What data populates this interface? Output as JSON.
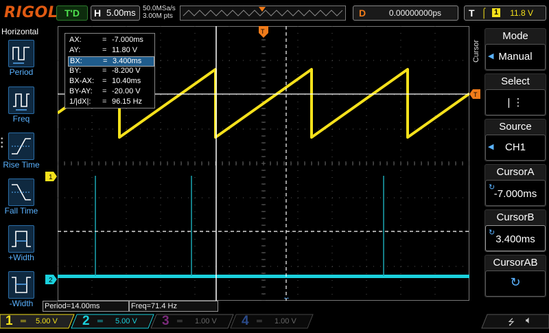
{
  "topbar": {
    "brand": "RIGOL",
    "run_status": "T'D",
    "horizontal": {
      "key": "H",
      "value": "5.00ms"
    },
    "sample_rate": "50.0MSa/s",
    "memory_depth": "3.00M pts",
    "delay": {
      "key": "D",
      "value": "0.00000000ps"
    },
    "trigger": {
      "key": "T",
      "source": "1",
      "level": "11.8 V"
    }
  },
  "left_menu": {
    "title": "Horizontal",
    "items": [
      {
        "label": "Period",
        "icon": "period-icon"
      },
      {
        "label": "Freq",
        "icon": "freq-icon"
      },
      {
        "label": "Rise Time",
        "icon": "rise-time-icon"
      },
      {
        "label": "Fall Time",
        "icon": "fall-time-icon"
      },
      {
        "label": "+Width",
        "icon": "positive-width-icon"
      },
      {
        "label": "-Width",
        "icon": "negative-width-icon"
      }
    ]
  },
  "cursor_readout": [
    {
      "k": "AX:",
      "e": "=",
      "v": "-7.000ms"
    },
    {
      "k": "AY:",
      "e": "=",
      "v": "11.80 V"
    },
    {
      "k": "BX:",
      "e": "=",
      "v": "3.400ms"
    },
    {
      "k": "BY:",
      "e": "=",
      "v": "-8.200 V"
    },
    {
      "k": "BX-AX:",
      "e": "=",
      "v": "10.40ms"
    },
    {
      "k": "BY-AY:",
      "e": "=",
      "v": "-20.00 V"
    },
    {
      "k": "1/|dX|:",
      "e": "=",
      "v": "96.15 Hz"
    }
  ],
  "markers": {
    "ch1": "1",
    "ch2": "2",
    "trigger_marker": "T"
  },
  "right_menu": {
    "vertical_title": "Cursor",
    "items": [
      {
        "title": "Mode",
        "value": "Manual"
      },
      {
        "title": "Select",
        "value": "| ⋮"
      },
      {
        "title": "Source",
        "value": "CH1"
      },
      {
        "title": "CursorA",
        "value": "-7.000ms"
      },
      {
        "title": "CursorB",
        "value": "3.400ms"
      },
      {
        "title": "CursorAB",
        "value": ""
      }
    ]
  },
  "measurements": {
    "period": "Period=14.00ms",
    "freq": "Freq=71.4 Hz"
  },
  "channels": [
    {
      "num": "1",
      "scale": "5.00 V",
      "color": "#f5e11b",
      "active": true
    },
    {
      "num": "2",
      "scale": "5.00 V",
      "color": "#1ad1dd",
      "active": true
    },
    {
      "num": "3",
      "scale": "1.00 V",
      "color": "#c23ac2",
      "active": false
    },
    {
      "num": "4",
      "scale": "1.00 V",
      "color": "#3a6bd8",
      "active": false
    }
  ],
  "colors": {
    "ch1": "#f5e11b",
    "ch2": "#1ad1dd",
    "accent": "#e05a12",
    "menu_blue": "#5ab2ff"
  }
}
